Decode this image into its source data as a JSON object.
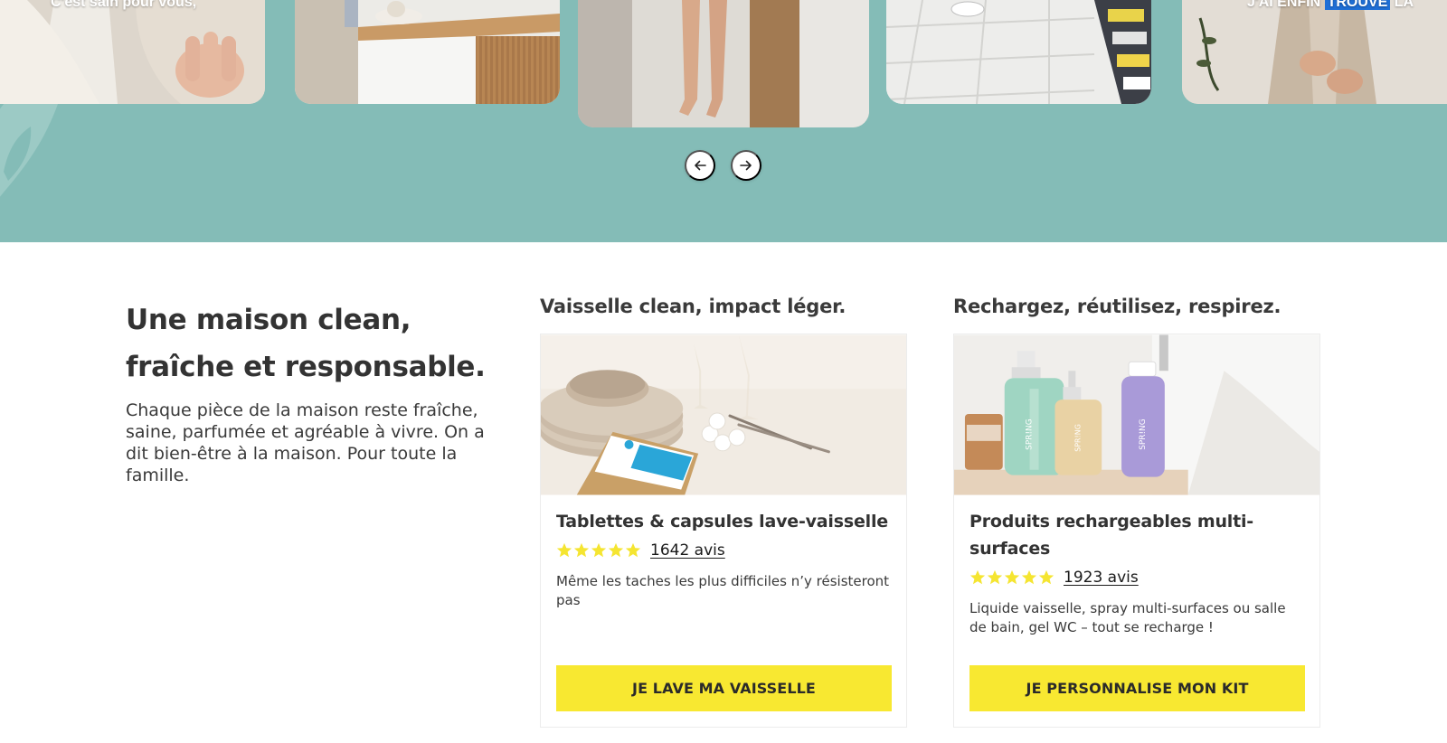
{
  "colors": {
    "band_teal": "#84bcb7",
    "cta_yellow": "#f8e831",
    "star_yellow": "#f5e531",
    "caption_highlight": "#1f6fd6"
  },
  "carousel": {
    "slides": [
      {
        "caption": "C'est sain pour vous,",
        "caption_parts": []
      },
      {
        "caption": ""
      },
      {
        "caption": ""
      },
      {
        "caption": ""
      },
      {
        "caption_pre": "J'AI ENFIN ",
        "caption_highlight": "TROUVÉ",
        "caption_post": " LA"
      }
    ],
    "prev_icon": "arrow-left-icon",
    "next_icon": "arrow-right-icon"
  },
  "intro": {
    "heading_line1": "Une maison clean,",
    "heading_line2": "fraîche et responsable.",
    "text": "Chaque pièce de la maison reste fraîche, saine, parfumée et agréable à vivre. On a dit bien-être à la maison. Pour toute la famille."
  },
  "cards": [
    {
      "column_title": "Vaisselle clean, impact léger.",
      "title": "Tablettes & capsules lave-vaisselle",
      "rating": 5,
      "reviews": "1642 avis",
      "description": "Même les taches les plus difficiles n’y résisteront pas",
      "cta": "JE LAVE MA VAISSELLE"
    },
    {
      "column_title": "Rechargez, réutilisez, respirez.",
      "title": "Produits rechargeables multi-surfaces",
      "rating": 5,
      "reviews": "1923 avis",
      "description": "Liquide vaisselle, spray multi-surfaces ou salle de bain, gel WC – tout se recharge !",
      "cta": "JE PERSONNALISE MON KIT",
      "bottle_labels": [
        "SPR!NG",
        "SPR!NG",
        "SPR!NG"
      ]
    }
  ]
}
